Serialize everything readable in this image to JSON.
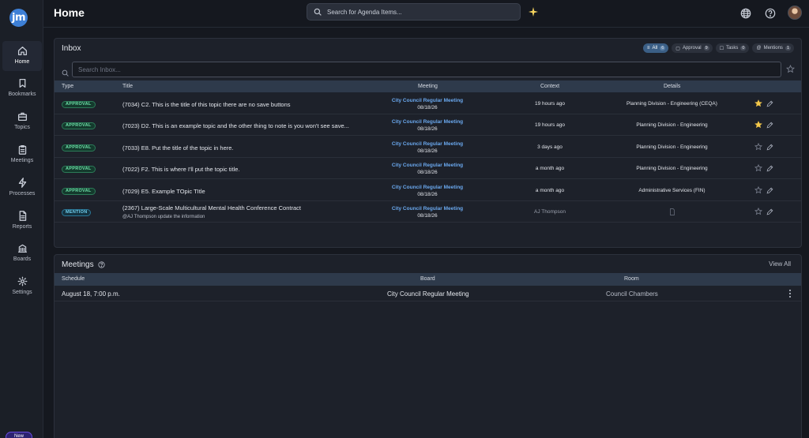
{
  "app": {
    "logo_text": "jm",
    "page_title": "Home",
    "new_label": "New"
  },
  "header": {
    "search_placeholder": "Search for Agenda Items..."
  },
  "sidebar": {
    "items": [
      {
        "label": "Home",
        "icon": "home-icon"
      },
      {
        "label": "Bookmarks",
        "icon": "bookmark-icon"
      },
      {
        "label": "Topics",
        "icon": "briefcase-icon"
      },
      {
        "label": "Meetings",
        "icon": "clipboard-icon"
      },
      {
        "label": "Processes",
        "icon": "lightning-icon"
      },
      {
        "label": "Reports",
        "icon": "document-icon"
      },
      {
        "label": "Boards",
        "icon": "building-icon"
      },
      {
        "label": "Settings",
        "icon": "gear-icon"
      }
    ]
  },
  "inbox": {
    "title": "Inbox",
    "search_placeholder": "Search Inbox...",
    "filters": [
      {
        "label": "All",
        "count": "6"
      },
      {
        "label": "Approval",
        "count": "9"
      },
      {
        "label": "Tasks",
        "count": "0"
      },
      {
        "label": "Mentions",
        "count": "1"
      }
    ],
    "columns": {
      "type": "Type",
      "title": "Title",
      "meeting": "Meeting",
      "context": "Context",
      "details": "Details"
    },
    "rows": [
      {
        "type": "APPROVAL",
        "number": "(7034)",
        "title": "C2. This is the title of this topic there are no save buttons",
        "sub": "",
        "meeting": "City Council Regular Meeting",
        "date": "08/18/26",
        "context": "19 hours ago",
        "details": "Planning Division - Engineering (CEQA)",
        "starred": true
      },
      {
        "type": "APPROVAL",
        "number": "(7023)",
        "title": "D2. This is an example topic and the other thing to note is you won't see save...",
        "sub": "",
        "meeting": "City Council Regular Meeting",
        "date": "08/18/26",
        "context": "19 hours ago",
        "details": "Planning Division - Engineering",
        "starred": true
      },
      {
        "type": "APPROVAL",
        "number": "(7033)",
        "title": "E8. Put the title of the topic in here.",
        "sub": "",
        "meeting": "City Council Regular Meeting",
        "date": "08/18/26",
        "context": "3 days ago",
        "details": "Planning Division - Engineering",
        "starred": false
      },
      {
        "type": "APPROVAL",
        "number": "(7022)",
        "title": "F2. This is where I'll put the topic title.",
        "sub": "",
        "meeting": "City Council Regular Meeting",
        "date": "08/18/26",
        "context": "a month ago",
        "details": "Planning Division - Engineering",
        "starred": false
      },
      {
        "type": "APPROVAL",
        "number": "(7029)",
        "title": "E5. Example TOpic TItle",
        "sub": "",
        "meeting": "City Council Regular Meeting",
        "date": "08/18/26",
        "context": "a month ago",
        "details": "Administrative Services (FIN)",
        "starred": false
      },
      {
        "type": "MENTION",
        "number": "(2367)",
        "title": "Large-Scale Multicultural Mental Health Conference Contract",
        "sub": "@AJ Thompson update the information",
        "meeting": "City Council Regular Meeting",
        "date": "08/18/26",
        "context": "AJ Thompson",
        "details": "",
        "starred": false
      }
    ]
  },
  "meetings": {
    "title": "Meetings",
    "view_all": "View All",
    "columns": {
      "schedule": "Schedule",
      "board": "Board",
      "room": "Room"
    },
    "rows": [
      {
        "schedule": "August 18, 7:00 p.m.",
        "board": "City Council Regular Meeting",
        "room": "Council Chambers"
      }
    ]
  },
  "colors": {
    "accent_blue": "#6aa8ee",
    "approval_green": "#6de0a8",
    "mention_cyan": "#6fd0ef",
    "star_yellow": "#f4c84a"
  }
}
